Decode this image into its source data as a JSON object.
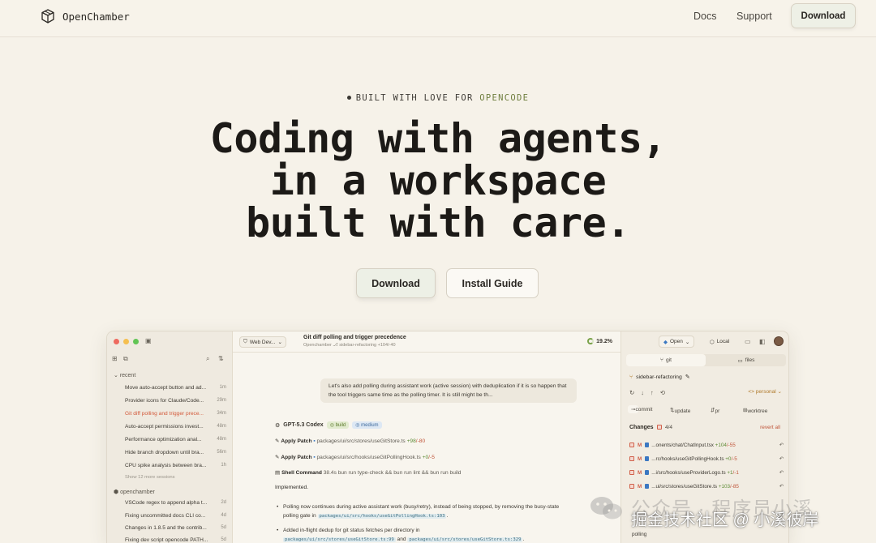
{
  "nav": {
    "brand": "OpenChamber",
    "links": [
      "Docs",
      "Support"
    ],
    "download": "Download"
  },
  "hero": {
    "tagline_prefix": "BUILT WITH LOVE FOR ",
    "tagline_accent": "OPENCODE",
    "headline_lines": [
      "Coding with agents,",
      "in a workspace",
      "built with care."
    ],
    "cta_primary": "Download",
    "cta_secondary": "Install Guide"
  },
  "app": {
    "left": {
      "group_recent": "recent",
      "sessions": [
        {
          "title": "Move auto-accept button and ad...",
          "age": "1m"
        },
        {
          "title": "Provider icons for Claude/Code...",
          "age": "29m"
        },
        {
          "title": "Git diff polling and trigger prece...",
          "age": "34m",
          "active": true
        },
        {
          "title": "Auto-accept permissions invest...",
          "age": "48m"
        },
        {
          "title": "Performance optimization anal...",
          "age": "48m"
        },
        {
          "title": "Hide branch dropdown until bra...",
          "age": "56m"
        },
        {
          "title": "CPU spike analysis between bra...",
          "age": "1h"
        }
      ],
      "show_more": "Show 12 more sessions",
      "group_project": "openchamber",
      "project_sessions": [
        {
          "title": "VSCode regex to append alpha t...",
          "age": "2d"
        },
        {
          "title": "Fixing uncommitted docs CLI co...",
          "age": "4d"
        },
        {
          "title": "Changes in 1.8.5 and the contrib...",
          "age": "5d"
        },
        {
          "title": "Fixing dev script opencode PATH...",
          "age": "5d"
        }
      ]
    },
    "center": {
      "workspace": "Web Dev...",
      "title": "Git diff polling and trigger precedence",
      "subtitle": "Openchamber  ⎇ sidebar-refactoring  +104/-40",
      "percent": "19.2%",
      "user_message": "Let's also add polling during assistant work (active session) with deduplication if it is so happen that the tool triggers same time as the polling timer. It is still might be th...",
      "model": "GPT-5.3 Codex",
      "chip_build": "◎ build",
      "chip_effort": "◎ medium",
      "tools": [
        {
          "label": "Apply Patch",
          "path": "packages/ui/src/stores/useGitStore.ts",
          "add": "+98",
          "del": "/-80"
        },
        {
          "label": "Apply Patch",
          "path": "packages/ui/src/hooks/useGitPollingHook.ts",
          "add": "+0",
          "del": "/-5"
        },
        {
          "label": "Shell Command",
          "path": "38.4s  bun run type-check && bun run lint && bun run build",
          "add": "",
          "del": ""
        }
      ],
      "implemented": "Implemented.",
      "bullet1_text": "Polling now continues during active assistant work (busy/retry), instead of being stopped, by removing the busy-state polling gate in ",
      "bullet1_code": "packages/ui/src/hooks/useGitPollingHook.ts:103",
      "bullet2_text": "Added in-flight dedup for git status fetches per directory in",
      "bullet2_code1": "packages/ui/src/stores/useGitStore.ts:99",
      "bullet2_and": " and ",
      "bullet2_code2": "packages/ui/src/stores/useGitStore.ts:329"
    },
    "right": {
      "open": "Open",
      "local": "Local",
      "tab_git": "git",
      "tab_files": "files",
      "branch": "sidebar-refactoring",
      "personal": "personal",
      "action_commit": "commit",
      "action_update": "update",
      "action_pr": "pr",
      "action_worktree": "worktree",
      "changes": "Changes",
      "changes_count": "4/4",
      "revert_all": "revert all",
      "files": [
        {
          "path": "...onents/chat/ChatInput.tsx",
          "add": "+104",
          "del": "/-55"
        },
        {
          "path": "...rc/hooks/useGitPollingHook.ts",
          "add": "+0",
          "del": "/-5"
        },
        {
          "path": "...i/src/hooks/useProviderLogo.ts",
          "add": "+1",
          "del": "/-1"
        },
        {
          "path": "...ui/src/stores/useGitStore.ts",
          "add": "+103",
          "del": "/-85"
        }
      ],
      "bottom_fragment": "polling"
    }
  },
  "watermark": {
    "line1": "公众号 · 程序员小溪",
    "line2": "掘金技术社区 @ 小溪彼岸"
  },
  "colors": {
    "background": "#f6f2e9",
    "accent_green": "#6f7e3e",
    "active_session": "#d2593a",
    "diff_add": "#5c8a34",
    "diff_del": "#c0553a"
  }
}
